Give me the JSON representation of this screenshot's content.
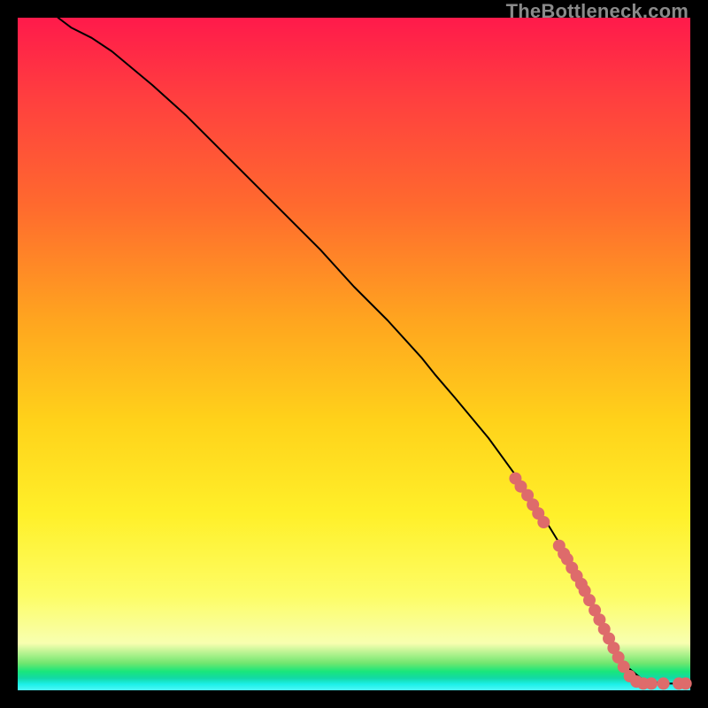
{
  "watermark": "TheBottleneck.com",
  "chart_data": {
    "type": "line",
    "title": "",
    "xlabel": "",
    "ylabel": "",
    "xlim": [
      0,
      100
    ],
    "ylim": [
      0,
      100
    ],
    "grid": false,
    "legend": false,
    "series": [
      {
        "name": "curve",
        "color": "#000000",
        "x": [
          6,
          8,
          11,
          14,
          17,
          20,
          25,
          30,
          35,
          40,
          45,
          50,
          55,
          60,
          62,
          65,
          70,
          74,
          78,
          82,
          85,
          88,
          90,
          93,
          96,
          100
        ],
        "y": [
          100,
          98.5,
          97,
          95,
          92.5,
          90,
          85.5,
          80.5,
          75.5,
          70.5,
          65.5,
          60,
          55,
          49.5,
          47,
          43.5,
          37.5,
          32,
          26,
          19.5,
          14,
          8,
          4,
          1.5,
          1.0,
          1.0
        ]
      }
    ],
    "markers": {
      "name": "dots",
      "color": "#de6b6b",
      "radius_px": 7,
      "points": [
        {
          "x": 74.0,
          "y": 31.5
        },
        {
          "x": 74.8,
          "y": 30.3
        },
        {
          "x": 75.8,
          "y": 29.0
        },
        {
          "x": 76.6,
          "y": 27.6
        },
        {
          "x": 77.4,
          "y": 26.3
        },
        {
          "x": 78.2,
          "y": 25.0
        },
        {
          "x": 80.5,
          "y": 21.5
        },
        {
          "x": 81.2,
          "y": 20.3
        },
        {
          "x": 81.7,
          "y": 19.5
        },
        {
          "x": 82.4,
          "y": 18.2
        },
        {
          "x": 83.1,
          "y": 17.0
        },
        {
          "x": 83.8,
          "y": 15.8
        },
        {
          "x": 84.3,
          "y": 14.8
        },
        {
          "x": 85.0,
          "y": 13.4
        },
        {
          "x": 85.8,
          "y": 11.9
        },
        {
          "x": 86.5,
          "y": 10.5
        },
        {
          "x": 87.2,
          "y": 9.1
        },
        {
          "x": 87.9,
          "y": 7.7
        },
        {
          "x": 88.6,
          "y": 6.3
        },
        {
          "x": 89.3,
          "y": 4.9
        },
        {
          "x": 90.1,
          "y": 3.5
        },
        {
          "x": 91.0,
          "y": 2.1
        },
        {
          "x": 92.0,
          "y": 1.3
        },
        {
          "x": 93.0,
          "y": 1.0
        },
        {
          "x": 94.2,
          "y": 1.0
        },
        {
          "x": 96.0,
          "y": 1.0
        },
        {
          "x": 98.3,
          "y": 1.0
        },
        {
          "x": 99.3,
          "y": 1.0
        }
      ]
    }
  }
}
